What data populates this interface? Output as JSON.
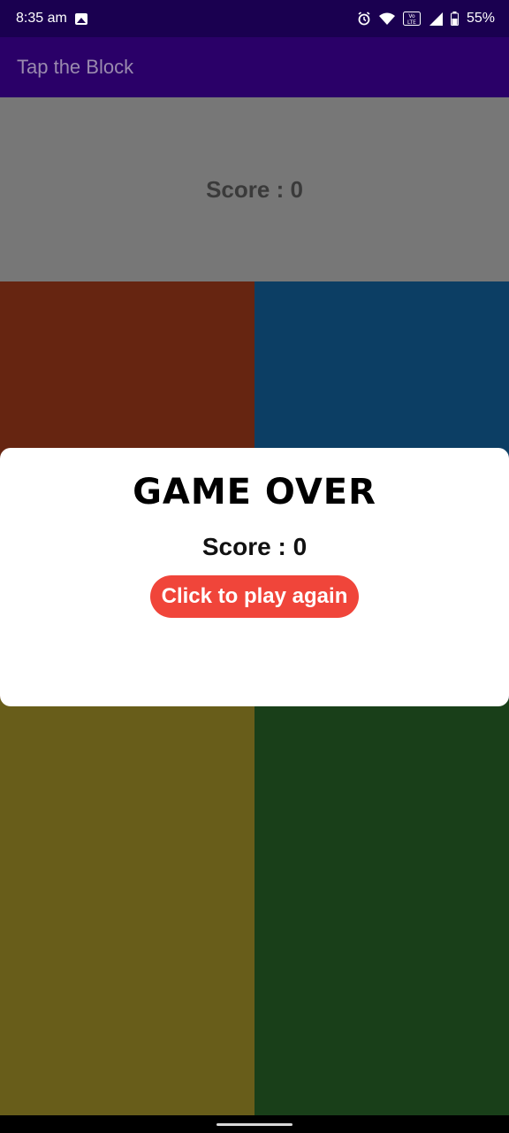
{
  "status_bar": {
    "time": "8:35 am",
    "battery": "55%",
    "icons": [
      "gallery-icon",
      "alarm-icon",
      "wifi-icon",
      "volte-icon",
      "signal-icon",
      "battery-icon"
    ]
  },
  "app_bar": {
    "title": "Tap the Block"
  },
  "header": {
    "score_text": "Score : 0"
  },
  "blocks": [
    {
      "position": "top-left",
      "color": "#662511"
    },
    {
      "position": "top-right",
      "color": "#0c3e64"
    },
    {
      "position": "bottom-left",
      "color": "#685d1a"
    },
    {
      "position": "bottom-right",
      "color": "#193f19"
    }
  ],
  "dialog": {
    "title": "GAME OVER",
    "score_text": "Score : 0",
    "button_label": "Click to play again",
    "button_color": "#f0453a"
  },
  "colors": {
    "status_bar": "#1a0050",
    "app_bar": "#2a0068",
    "header": "#777777"
  }
}
